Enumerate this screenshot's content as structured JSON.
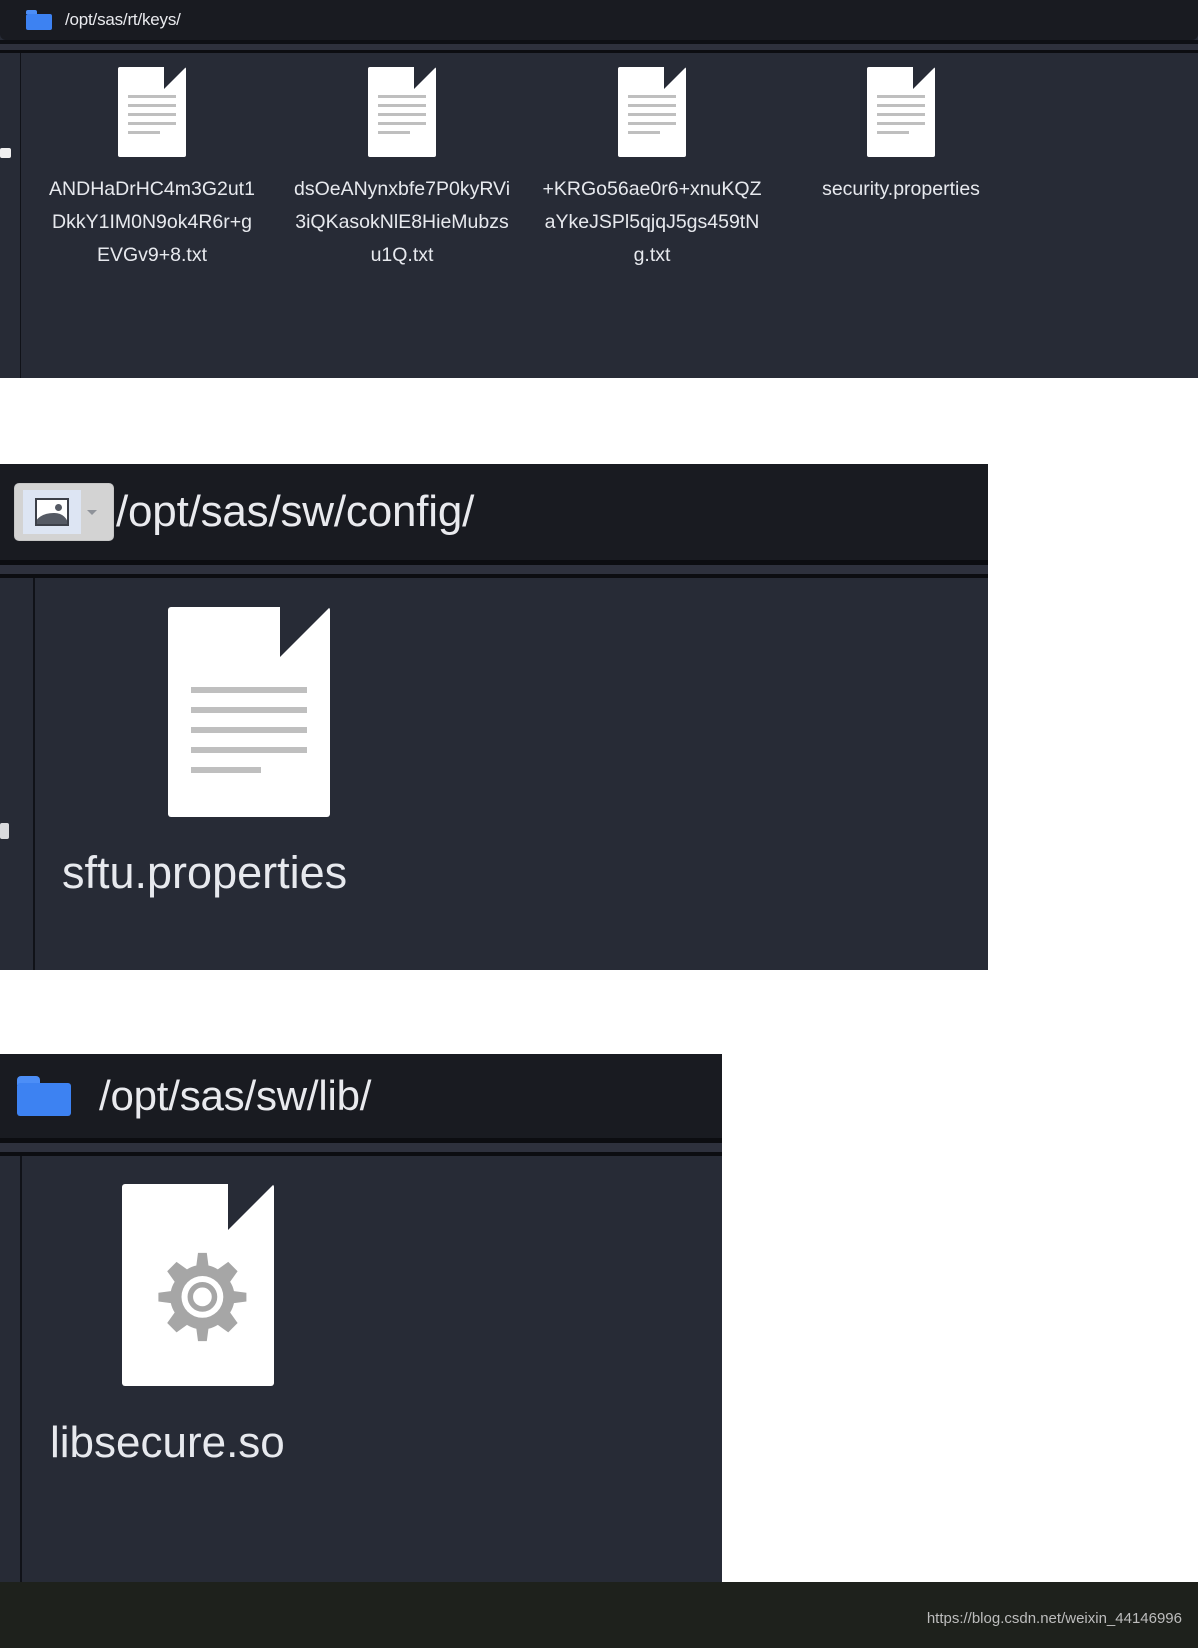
{
  "panels": [
    {
      "id": "keys-panel",
      "path": "/opt/sas/rt/keys/",
      "header_icon": "folder-icon",
      "files": [
        {
          "name": "ANDHaDrHC4m3G2ut1DkkY1IM0N9ok4R6r+gEVGv9+8.txt",
          "icon": "text-file-icon"
        },
        {
          "name": "dsOeANynxbfe7P0kyRVi3iQKasokNlE8HieMubzsu1Q.txt",
          "icon": "text-file-icon"
        },
        {
          "name": "+KRGo56ae0r6+xnuKQZaYkeJSPl5qjqJ5gs459tNg.txt",
          "icon": "text-file-icon"
        },
        {
          "name": "security.properties",
          "icon": "text-file-icon"
        }
      ]
    },
    {
      "id": "config-panel",
      "path": "/opt/sas/sw/config/",
      "header_icon": "broken-image-icon",
      "files": [
        {
          "name": "sftu.properties",
          "icon": "text-file-icon"
        }
      ]
    },
    {
      "id": "lib-panel",
      "path": "/opt/sas/sw/lib/",
      "header_icon": "folder-icon",
      "files": [
        {
          "name": "libsecure.so",
          "icon": "gear-file-icon"
        }
      ]
    }
  ],
  "watermark": {
    "text": "https://blog.csdn.net/weixin_44146996"
  },
  "colors": {
    "header_bg": "#191b21",
    "body_bg": "#272b36",
    "folder_blue": "#3d82f2",
    "text": "#e7e9ee",
    "doc_white": "#ffffff",
    "doc_line": "#bfbfbf",
    "gear_gray": "#a6a6a6",
    "watermark_bg": "#1e211c"
  }
}
